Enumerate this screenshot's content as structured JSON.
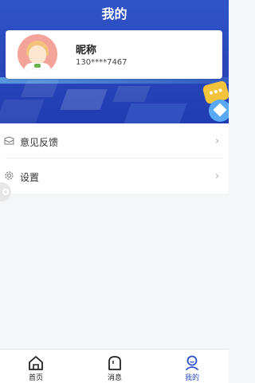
{
  "header": {
    "title": "我的"
  },
  "profile": {
    "nickname": "昵称",
    "phone": "130****7467"
  },
  "menu": {
    "items": [
      {
        "label": "意见反馈",
        "icon": "envelope-icon"
      },
      {
        "label": "设置",
        "icon": "gear-icon"
      }
    ]
  },
  "bottom_nav": {
    "items": [
      {
        "label": "首页",
        "icon": "home-icon"
      },
      {
        "label": "消息",
        "icon": "message-icon"
      },
      {
        "label": "我的",
        "icon": "user-icon",
        "active": true
      }
    ]
  },
  "colors": {
    "banner": "#2b49bd",
    "accent": "#2b4fc6",
    "background": "#f5f6f8"
  }
}
